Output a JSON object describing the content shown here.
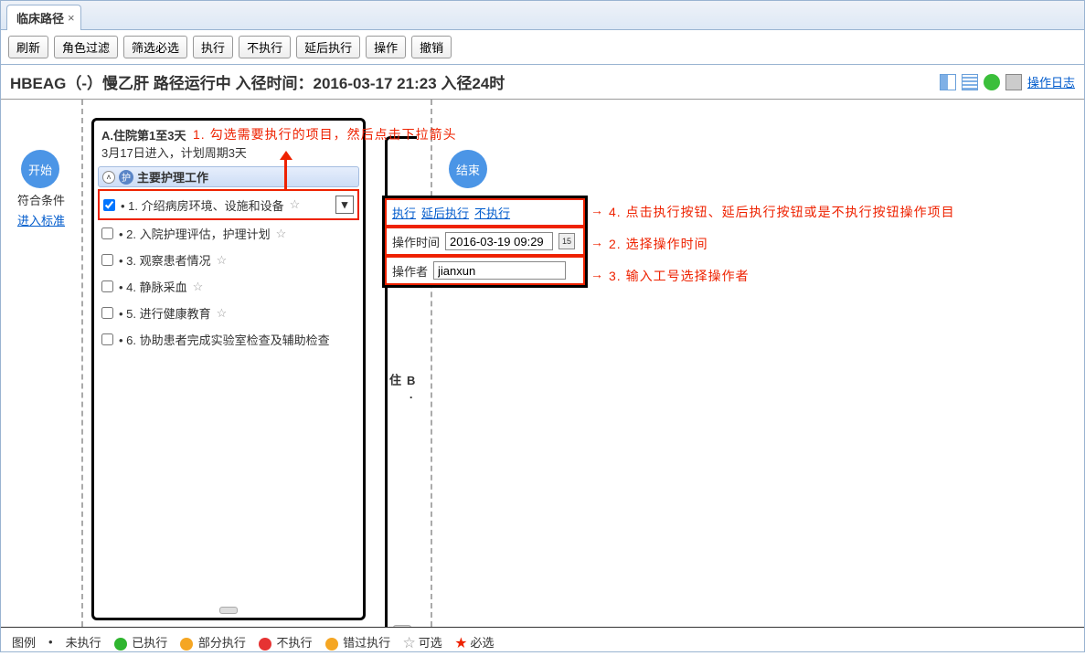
{
  "tab": {
    "title": "临床路径"
  },
  "toolbar": {
    "refresh": "刷新",
    "role_filter": "角色过滤",
    "filter_required": "筛选必选",
    "execute": "执行",
    "not_execute": "不执行",
    "delay_execute": "延后执行",
    "operate": "操作",
    "undo": "撤销"
  },
  "header": {
    "title": "HBEAG（-）慢乙肝   路径运行中 入径时间：2016-03-17 21:23 入径24时",
    "log_link": "操作日志"
  },
  "side": {
    "start": "开始",
    "end": "结束",
    "condition": "符合条件",
    "enter_standard": "进入标准"
  },
  "panel_a": {
    "title": "A.住院第1至3天",
    "subtitle": "3月17日进入，计划周期3天",
    "section_label": "主要护理工作",
    "badge": "护",
    "items": [
      {
        "label": "• 1. 介绍病房环境、设施和设备",
        "checked": true,
        "highlighted": true,
        "star": true
      },
      {
        "label": "• 2. 入院护理评估，护理计划",
        "checked": false,
        "star": true
      },
      {
        "label": "• 3. 观察患者情况",
        "checked": false,
        "star": true
      },
      {
        "label": "• 4. 静脉采血",
        "checked": false,
        "star": true
      },
      {
        "label": "• 5. 进行健康教育",
        "checked": false,
        "star": true
      },
      {
        "label": "• 6. 协助患者完成实验室检查及辅助检查",
        "checked": false,
        "star": false
      }
    ]
  },
  "panel_b": {
    "letter": "B.",
    "label": "住"
  },
  "popup": {
    "exec": "执行",
    "delay": "延后执行",
    "noexec": "不执行",
    "time_label": "操作时间",
    "time_value": "2016-03-19 09:29",
    "cal_text": "15",
    "operator_label": "操作者",
    "operator_value": "jianxun"
  },
  "annotations": {
    "a1": "1. 勾选需要执行的项目，然后点击下拉箭头",
    "a2": "2. 选择操作时间",
    "a3": "3. 输入工号选择操作者",
    "a4": "4. 点击执行按钮、延后执行按钮或是不执行按钮操作项目"
  },
  "legend": {
    "title": "图例",
    "not_exec": "未执行",
    "done": "已执行",
    "partial": "部分执行",
    "not": "不执行",
    "missed": "错过执行",
    "optional": "可选",
    "required": "必选",
    "star": "☆",
    "star_red": "★"
  }
}
